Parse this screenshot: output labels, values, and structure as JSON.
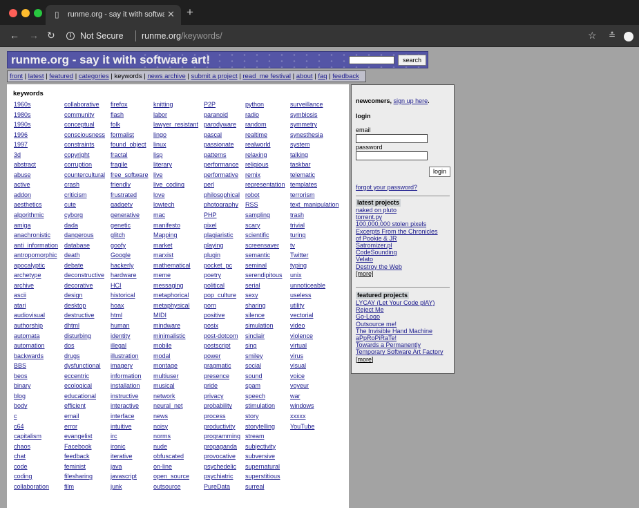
{
  "browser": {
    "tab_title": "runme.org - say it with softwar",
    "not_secure_label": "Not Secure",
    "url_host": "runme.org",
    "url_path": "/keywords/"
  },
  "site": {
    "title": "runme.org - say it with software art!",
    "search_button": "search",
    "nav": [
      "front",
      "latest",
      "featured",
      "categories",
      "keywords",
      "news archive",
      "submit a project",
      "read_me festival",
      "about",
      "faq",
      "feedback"
    ],
    "nav_current": "keywords"
  },
  "keywords": {
    "heading": "keywords",
    "columns": [
      [
        "1960s",
        "1980s",
        "1990s",
        "1996",
        "1997",
        "3d",
        "abstract",
        "abuse",
        "active",
        "addon",
        "aesthetics",
        "algorithmic",
        "amiga",
        "anachronistic",
        "anti_information",
        "antropomorphic",
        "apocalyptic",
        "archetype",
        "archive",
        "ascii",
        "atari",
        "audiovisual",
        "authorship",
        "automata",
        "automation",
        "backwards",
        "BBS",
        "beos",
        "binary",
        "blog",
        "body",
        "c",
        "c64",
        "capitalism",
        "chaos",
        "chat",
        "code",
        "coding",
        "collaboration"
      ],
      [
        "collaborative",
        "community",
        "conceptual",
        "consciousness",
        "constraints",
        "copyright",
        "corruption",
        "countercultural",
        "crash",
        "criticism",
        "cute",
        "cyborg",
        "dada",
        "dangerous",
        "database",
        "death",
        "debate",
        "deconstructive",
        "decorative",
        "design",
        "desktop",
        "destructive",
        "dhtml",
        "disturbing",
        "dos",
        "drugs",
        "dysfunctional",
        "eccentric",
        "ecological",
        "educational",
        "efficient",
        "email",
        "error",
        "evangelist",
        "Facebook",
        "feedback",
        "feminist",
        "filesharing",
        "film"
      ],
      [
        "firefox",
        "flash",
        "folk",
        "formalist",
        "found_object",
        "fractal",
        "fragile",
        "free_software",
        "friendly",
        "frustrated",
        "gadgety",
        "generative",
        "genetic",
        "glitch",
        "goofy",
        "Google",
        "hackerly",
        "hardware",
        "HCI",
        "historical",
        "hoax",
        "html",
        "human",
        "identity",
        "illegal",
        "illustration",
        "imagery",
        "information",
        "installation",
        "instructive",
        "interactive",
        "interface",
        "intuitive",
        "irc",
        "ironic",
        "iterative",
        "java",
        "javascript",
        "junk"
      ],
      [
        "knitting",
        "labor",
        "lawyer_resistant",
        "lingo",
        "linux",
        "lisp",
        "literary",
        "live",
        "live_coding",
        "love",
        "lowtech",
        "mac",
        "manifesto",
        "Mapping",
        "market",
        "marxist",
        "mathematical",
        "meme",
        "messaging",
        "metaphorical",
        "metaphysical",
        "MIDI",
        "mindware",
        "minimalistic",
        "mobile",
        "modal",
        "montage",
        "multiuser",
        "musical",
        "network",
        "neural_net",
        "news",
        "noisy",
        "norms",
        "nude",
        "obfuscated",
        "on-line",
        "open_source",
        "outsource"
      ],
      [
        "P2P",
        "paranoid",
        "parodyware",
        "pascal",
        "passionate",
        "patterns",
        "performance",
        "performative",
        "perl",
        "philosophical",
        "photography",
        "PHP",
        "pixel",
        "plagiaristic",
        "playing",
        "plugin",
        "pocket_pc",
        "poetry",
        "political",
        "pop_culture",
        "porn",
        "positive",
        "posix",
        "post-dotcom",
        "postscript",
        "power",
        "pragmatic",
        "presence",
        "pride",
        "privacy",
        "probability",
        "process",
        "productivity",
        "programming",
        "propaganda",
        "provocative",
        "psychedelic",
        "psychiatric",
        "PureData"
      ],
      [
        "python",
        "radio",
        "random",
        "realtime",
        "realworld",
        "relaxing",
        "religious",
        "remix",
        "representation",
        "robot",
        "RSS",
        "sampling",
        "scary",
        "scientific",
        "screensaver",
        "semantic",
        "seminal",
        "serendipitous",
        "serial",
        "sexy",
        "sharing",
        "silence",
        "simulation",
        "sinclair",
        "sing",
        "smiley",
        "social",
        "sound",
        "spam",
        "speech",
        "stimulation",
        "story",
        "storytelling",
        "stream",
        "subjectivity",
        "subversive",
        "supernatural",
        "superstitious",
        "surreal"
      ],
      [
        "surveillance",
        "symbiosis",
        "symmetry",
        "synesthesia",
        "system",
        "talking",
        "taskbar",
        "telematic",
        "templates",
        "terrorism",
        "text_manipulation",
        "trash",
        "trivial",
        "turing",
        "tv",
        "Twitter",
        "typing",
        "unix",
        "unnoticeable",
        "useless",
        "utility",
        "vectorial",
        "video",
        "violence",
        "virtual",
        "virus",
        "visual",
        "voice",
        "voyeur",
        "war",
        "windows",
        "xxxxx",
        "YouTube"
      ]
    ]
  },
  "sidebar": {
    "newcomers_text": "newcomers,",
    "signup_link": "sign up here",
    "login_heading": "login",
    "email_label": "email",
    "password_label": "password",
    "login_button": "login",
    "forgot_link": "forgot your password?",
    "latest_heading": "latest projects",
    "latest_projects": [
      "naked on pluto",
      "torrent.py",
      "100,000,000 stolen pixels",
      "Excerpts From the Chronicles",
      "of Pookie & JR",
      "Satromizer.pl",
      "CodeSounding",
      "Velato",
      "Destroy the Web",
      "[more]"
    ],
    "featured_heading": "featured projects",
    "featured_projects": [
      "LYCAY (Let Your Code plAY)",
      "Reject Me",
      "Go-Logo",
      "Outsource me!",
      "The Invisible Hand Machine",
      "aPpRoPiRaTe!",
      "Towards a Permanently",
      "Temporary Software Art Factory",
      "[more]"
    ]
  }
}
